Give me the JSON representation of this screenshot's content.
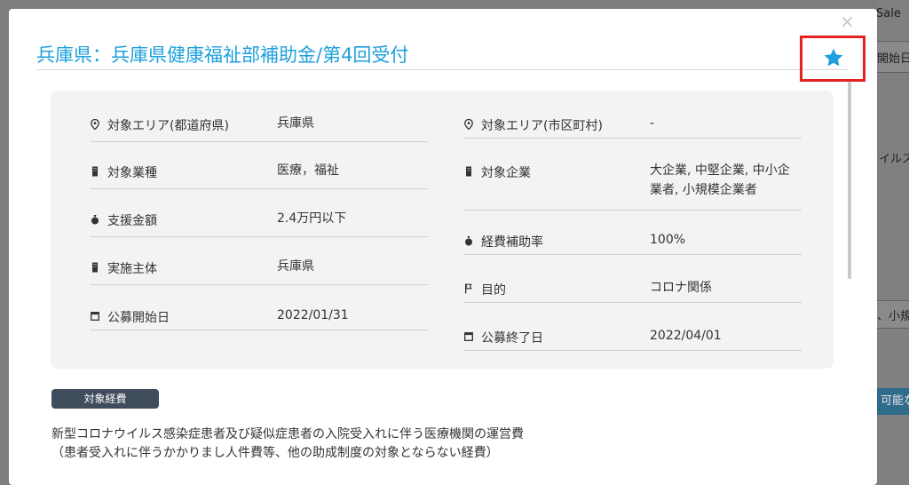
{
  "background": {
    "fragments": [
      "Sale",
      "開始日",
      "イルス",
      "、小規",
      "可能な"
    ]
  },
  "modal": {
    "close_glyph": "×",
    "title": "兵庫県：兵庫県健康福祉部補助金/第4回受付",
    "star_icon": "star-icon",
    "accent_color": "#1ea0dc",
    "highlight_color": "#e52222",
    "left_fields": [
      {
        "icon": "location-pin-icon",
        "label": "対象エリア(都道府県)",
        "value": "兵庫県"
      },
      {
        "icon": "building-icon",
        "label": "対象業種",
        "value": "医療，福祉"
      },
      {
        "icon": "money-bag-icon",
        "label": "支援金額",
        "value": "2.4万円以下"
      },
      {
        "icon": "building-icon",
        "label": "実施主体",
        "value": "兵庫県"
      },
      {
        "icon": "calendar-icon",
        "label": "公募開始日",
        "value": "2022/01/31"
      }
    ],
    "right_fields": [
      {
        "icon": "location-pin-icon",
        "label": "対象エリア(市区町村)",
        "value": "-"
      },
      {
        "icon": "building-icon",
        "label": "対象企業",
        "value_lines": [
          "大企業, 中堅企業, 中小企",
          "業者, 小規模企業者"
        ]
      },
      {
        "icon": "money-bag-icon",
        "label": "経費補助率",
        "value": "100%"
      },
      {
        "icon": "flag-icon",
        "label": "目的",
        "value": "コロナ関係"
      },
      {
        "icon": "calendar-icon",
        "label": "公募終了日",
        "value": "2022/04/01"
      }
    ],
    "tag_label": "対象経費",
    "description_lines": [
      "新型コロナウイルス感染症患者及び疑似症患者の入院受入れに伴う医療機関の運営費",
      "（患者受入れに伴うかかりまし人件費等、他の助成制度の対象とならない経費）"
    ]
  }
}
